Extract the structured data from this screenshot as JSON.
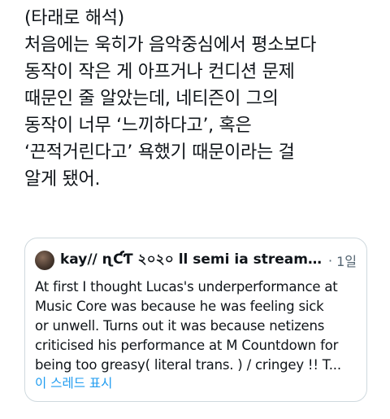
{
  "tweet": {
    "lines": [
      "(타래로 해석)",
      "처음에는 욱히가 음악중심에서 평소보다",
      "동작이 작은 게 아프거나 컨디션 문제",
      "때문인 줄 알았는데, 네티즌이 그의",
      "동작이 너무 ‘느끼하다고’, 혹은",
      "‘끈적거린다고’ 욕했기 때문이라는 걸",
      "알게 됐어."
    ]
  },
  "quote": {
    "author": "kay// ɳƇƬ ২০২০ ll semi ia streaming...",
    "separator": "·",
    "time": "1일",
    "lines": [
      "At first I thought Lucas's underperformance at",
      "Music Core was because he was feeling sick",
      "or unwell. Turns out it was because netizens",
      "criticised his performance at M Countdown for",
      "being too greasy( literal trans. ) / cringey !! T..."
    ],
    "show_thread": "이 스레드 표시"
  }
}
